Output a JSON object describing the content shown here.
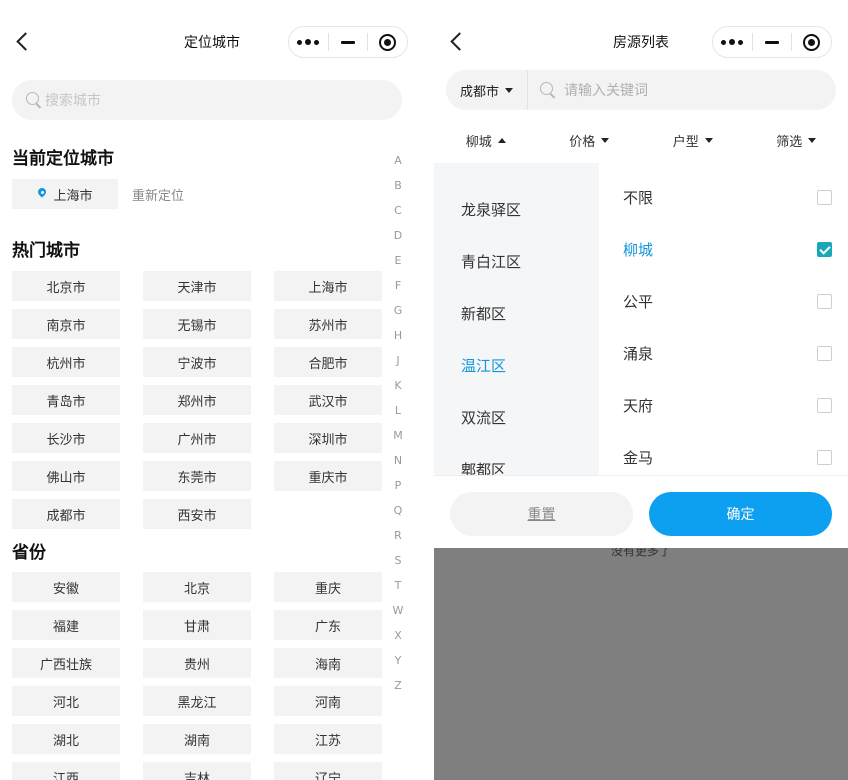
{
  "left": {
    "title": "定位城市",
    "search_placeholder": "搜索城市",
    "current_section": "当前定位城市",
    "current_city": "上海市",
    "relocate": "重新定位",
    "hot_section": "热门城市",
    "hot_cities": [
      "北京市",
      "天津市",
      "上海市",
      "南京市",
      "无锡市",
      "苏州市",
      "杭州市",
      "宁波市",
      "合肥市",
      "青岛市",
      "郑州市",
      "武汉市",
      "长沙市",
      "广州市",
      "深圳市",
      "佛山市",
      "东莞市",
      "重庆市",
      "成都市",
      "西安市"
    ],
    "province_section": "省份",
    "provinces": [
      "安徽",
      "北京",
      "重庆",
      "福建",
      "甘肃",
      "广东",
      "广西壮族",
      "贵州",
      "海南",
      "河北",
      "黑龙江",
      "河南",
      "湖北",
      "湖南",
      "江苏",
      "江西",
      "吉林",
      "辽宁"
    ],
    "alphabet": [
      "A",
      "B",
      "C",
      "D",
      "E",
      "F",
      "G",
      "H",
      "J",
      "K",
      "L",
      "M",
      "N",
      "P",
      "Q",
      "R",
      "S",
      "T",
      "W",
      "X",
      "Y",
      "Z"
    ]
  },
  "right": {
    "title": "房源列表",
    "city": "成都市",
    "search_placeholder": "请输入关键词",
    "filters": [
      "柳城",
      "价格",
      "户型",
      "筛选"
    ],
    "districts": [
      "龙泉驿区",
      "青白江区",
      "新都区",
      "温江区",
      "双流区",
      "郫都区"
    ],
    "active_district": "温江区",
    "areas": [
      {
        "label": "不限",
        "checked": false
      },
      {
        "label": "柳城",
        "checked": true
      },
      {
        "label": "公平",
        "checked": false
      },
      {
        "label": "涌泉",
        "checked": false
      },
      {
        "label": "天府",
        "checked": false
      },
      {
        "label": "金马",
        "checked": false
      }
    ],
    "reset": "重置",
    "confirm": "确定",
    "no_more": "没有更多了"
  },
  "colors": {
    "accent": "#1296db",
    "checkbox": "#1aa7b8",
    "overlay": "#7f7f7f"
  }
}
